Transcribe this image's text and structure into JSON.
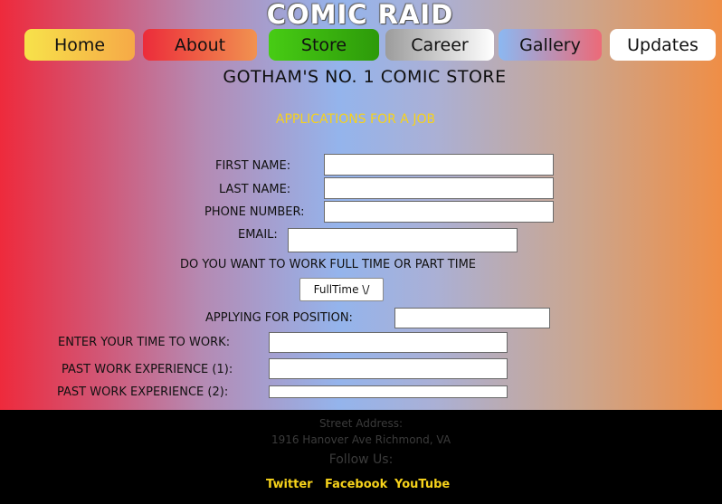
{
  "header": {
    "logo": "COMIC RAID",
    "nav": [
      {
        "label": "Home",
        "bg": "linear-gradient(to right,#f7e24a,#f6a947)"
      },
      {
        "label": "About",
        "bg": "linear-gradient(to right,#ec2c3a,#f19250)"
      },
      {
        "label": "Store",
        "bg": "linear-gradient(to right,#47cc14,#2d9a0a)"
      },
      {
        "label": "Career",
        "bg": "linear-gradient(to right,#9c9c9c,#ffffff)"
      },
      {
        "label": "Gallery",
        "bg": "linear-gradient(to right,#8bb8f2,#ec6a78)"
      },
      {
        "label": "Updates",
        "bg": "#ffffff"
      }
    ]
  },
  "main": {
    "title": "GOTHAM'S NO. 1 COMIC STORE",
    "subtitle": "APPLICATIONS FOR A JOB"
  },
  "form": {
    "first_name_label": "FIRST NAME:",
    "last_name_label": "LAST NAME:",
    "phone_label": "PHONE NUMBER:",
    "email_label": "EMAIL:",
    "work_type_question": "DO YOU WANT TO WORK FULL TIME OR PART TIME",
    "work_type_selected": "FullTime \\/",
    "position_label": "APPLYING FOR POSITION:",
    "time_label": "ENTER YOUR TIME TO WORK:",
    "exp1_label": "PAST WORK EXPERIENCE (1):",
    "exp2_label": "PAST WORK EXPERIENCE (2):"
  },
  "footer": {
    "street_label": "Street Address:",
    "address": "1916 Hanover Ave Richmond, VA",
    "follow": "Follow Us:",
    "social": [
      "Twitter",
      "Facebook",
      "YouTube"
    ],
    "accent_color": "#f6d21b"
  }
}
